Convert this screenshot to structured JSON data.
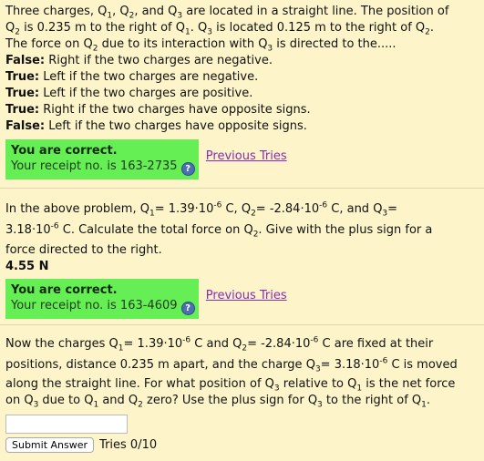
{
  "q1": {
    "text_lines": [
      [
        "Three charges, Q",
        "1",
        ", Q",
        "2",
        ", and Q",
        "3",
        " are located in a straight line. The position of"
      ],
      [
        "Q",
        "2",
        " is 0.235 m to the right of Q",
        "1",
        ". Q",
        "3",
        " is located 0.125 m to the right of Q",
        "2",
        "."
      ],
      [
        "The force on Q",
        "2",
        " due to its interaction with Q",
        "3",
        " is directed to the....."
      ]
    ],
    "statements": [
      {
        "verdict": "False:",
        "text": "Right if the two charges are negative."
      },
      {
        "verdict": "True:",
        "text": "Left if the two charges are negative."
      },
      {
        "verdict": "True:",
        "text": "Left if the two charges are positive."
      },
      {
        "verdict": "True:",
        "text": "Right if the two charges have opposite signs."
      },
      {
        "verdict": "False:",
        "text": "Left if the two charges have opposite signs."
      }
    ],
    "result_title": "You are correct.",
    "receipt": "Your receipt no. is 163-2735",
    "previous_tries": "Previous Tries"
  },
  "q2": {
    "line1": "In the above problem, Q",
    "q1_val": "= 1.39·10",
    "exp1": "-6",
    "c1": " C, Q",
    "q2_val": "= -2.84·10",
    "exp2": "-6",
    "c2": " C, and Q",
    "q3_eq": "=",
    "line2a": "3.18·10",
    "exp3": "-6",
    "line2b": " C. Calculate the total force on Q",
    "line2c": ". Give with the plus sign for a",
    "line3": "force directed to the right.",
    "answer": "4.55 N",
    "result_title": "You are correct.",
    "receipt": "Your receipt no. is 163-4609",
    "previous_tries": "Previous Tries"
  },
  "q3": {
    "l1a": "Now the charges Q",
    "l1b": "= 1.39·10",
    "l1e1": "-6",
    "l1c": " C and Q",
    "l1d": "= -2.84·10",
    "l1e2": "-6",
    "l1f": " C are fixed at their",
    "l2a": "positions, distance 0.235 m apart, and the charge Q",
    "l2b": "= 3.18·10",
    "l2e": "-6",
    "l2c": " C is moved",
    "l3": "along the straight line. For what position of Q",
    "l3b": " relative to Q",
    "l3c": " is the net force",
    "l4a": "on Q",
    "l4b": " due to Q",
    "l4c": " and Q",
    "l4d": " zero? Use the plus sign for Q",
    "l4e": " to the right of Q",
    "l4f": ".",
    "input_value": "",
    "submit_label": "Submit Answer",
    "tries": "Tries 0/10"
  },
  "help_glyph": "?",
  "colors": {
    "background": "#fdf5c9",
    "correct_box": "#66ee55",
    "link": "#8b2ab0"
  }
}
